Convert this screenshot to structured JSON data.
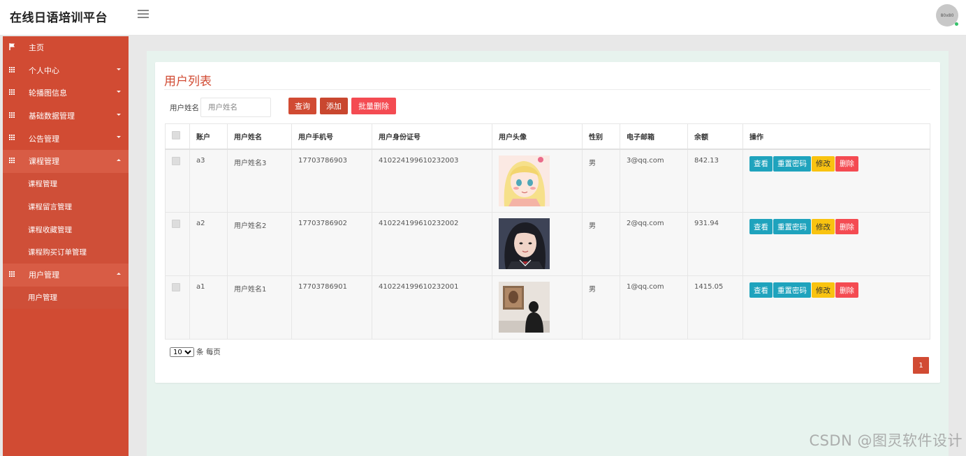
{
  "header": {
    "brand": "在线日语培训平台",
    "avatar_text": "80x80"
  },
  "sidebar": {
    "items": [
      {
        "label": "主页",
        "icon": "flag-icon",
        "has_caret": false
      },
      {
        "label": "个人中心",
        "icon": "grid-icon",
        "has_caret": true
      },
      {
        "label": "轮播图信息",
        "icon": "grid-icon",
        "has_caret": true
      },
      {
        "label": "基础数据管理",
        "icon": "grid-icon",
        "has_caret": true
      },
      {
        "label": "公告管理",
        "icon": "grid-icon",
        "has_caret": true
      },
      {
        "label": "课程管理",
        "icon": "grid-icon",
        "has_caret": true,
        "open": true,
        "children": [
          "课程管理",
          "课程留言管理",
          "课程收藏管理",
          "课程购买订单管理"
        ]
      },
      {
        "label": "用户管理",
        "icon": "grid-icon",
        "has_caret": true,
        "open": true,
        "children": [
          "用户管理"
        ]
      }
    ]
  },
  "panel": {
    "title": "用户列表",
    "search": {
      "label": "用户姓名",
      "placeholder": "用户姓名",
      "value": ""
    },
    "buttons": {
      "query": "查询",
      "add": "添加",
      "batch_delete": "批量删除"
    }
  },
  "table": {
    "columns": [
      "",
      "账户",
      "用户姓名",
      "用户手机号",
      "用户身份证号",
      "用户头像",
      "性别",
      "电子邮箱",
      "余额",
      "操作"
    ],
    "rows": [
      {
        "account": "a3",
        "name": "用户姓名3",
        "phone": "17703786903",
        "id_card": "410224199610232003",
        "avatar": "anime-girl-avatar",
        "gender": "男",
        "email": "3@qq.com",
        "balance": "842.13"
      },
      {
        "account": "a2",
        "name": "用户姓名2",
        "phone": "17703786902",
        "id_card": "410224199610232002",
        "avatar": "girl-portrait-avatar",
        "gender": "男",
        "email": "2@qq.com",
        "balance": "931.94"
      },
      {
        "account": "a1",
        "name": "用户姓名1",
        "phone": "17703786901",
        "id_card": "410224199610232001",
        "avatar": "gallery-person-avatar",
        "gender": "男",
        "email": "1@qq.com",
        "balance": "1415.05"
      }
    ],
    "actions": {
      "view": "查看",
      "reset": "重置密码",
      "edit": "修改",
      "delete": "删除"
    }
  },
  "pagination": {
    "page_size": "10",
    "page_size_suffix": "条 每页",
    "current_page": "1"
  },
  "watermark": "CSDN @图灵软件设计",
  "colors": {
    "primary": "#d14b33",
    "info": "#1fa3bd",
    "warning": "#f9c310",
    "danger": "#f44b52"
  }
}
